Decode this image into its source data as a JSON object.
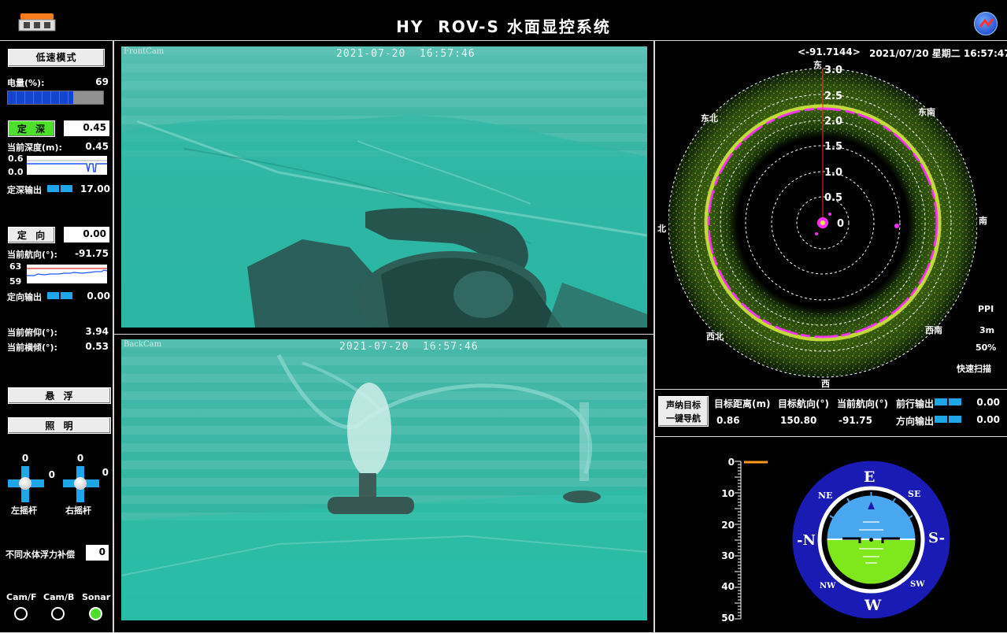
{
  "header": {
    "title": "HY  ROV-S 水面显控系统"
  },
  "left": {
    "mode_button": "低速模式",
    "battery_label": "电量(%):",
    "battery_value": "69",
    "battery_percent": 69,
    "depth_hold_button": "定  深",
    "depth_setpoint": "0.45",
    "current_depth_label": "当前深度(m):",
    "current_depth_value": "0.45",
    "depth_chart_max": "0.6",
    "depth_chart_min": "0.0",
    "depth_output_label": "定深输出",
    "depth_output_value": "17.00",
    "heading_hold_button": "定  向",
    "heading_setpoint": "0.00",
    "current_heading_label": "当前航向(°):",
    "current_heading_value": "-91.75",
    "heading_chart_max": "63",
    "heading_chart_min": "59",
    "heading_output_label": "定向输出",
    "heading_output_value": "0.00",
    "pitch_label": "当前俯仰(°):",
    "pitch_value": "3.94",
    "roll_label": "当前横倾(°):",
    "roll_value": "0.53",
    "hover_button": "悬  浮",
    "light_button": "照  明",
    "left_stick": {
      "top": "0",
      "right": "0",
      "label": "左摇杆"
    },
    "right_stick": {
      "top": "0",
      "right": "0",
      "label": "右摇杆"
    },
    "buoyancy_label": "不同水体浮力补偿",
    "buoyancy_value": "0",
    "sources": [
      {
        "label": "Cam/F",
        "selected": false
      },
      {
        "label": "Cam/B",
        "selected": false
      },
      {
        "label": "Sonar",
        "selected": true
      }
    ]
  },
  "cameras": {
    "front": {
      "name": "FrontCam",
      "timestamp": "2021-07-20  16:57:46"
    },
    "back": {
      "name": "BackCam",
      "timestamp": "2021-07-20  16:57:46"
    }
  },
  "sonar": {
    "heading_readout": "<-91.7144>",
    "datetime": "2021/07/20 星期二 16:57:47",
    "compass_labels": {
      "east": "东",
      "southeast": "东南",
      "south": "南",
      "southwest": "西南",
      "west": "西",
      "northwest": "西北",
      "north": "北",
      "northeast": "东北"
    },
    "range_labels": [
      "3.0",
      "2.5",
      "2.0",
      "1.5",
      "1.0",
      "0.5",
      "0"
    ],
    "mode": "PPI",
    "range": "3m",
    "gain": "50%",
    "scan": "快速扫描",
    "nav_button_line1": "声纳目标",
    "nav_button_line2": "一键导航",
    "target_distance_label": "目标距离(m)",
    "target_distance_value": "0.86",
    "target_heading_label": "目标航向(°)",
    "target_heading_value": "150.80",
    "current_heading_label": "当前航向(°)",
    "current_heading_value": "-91.75",
    "forward_output_label": "前行输出",
    "forward_output_value": "0.00",
    "direction_output_label": "方向输出",
    "direction_output_value": "0.00"
  },
  "depth_scale": {
    "ticks": [
      "0",
      "10",
      "20",
      "30",
      "40",
      "50"
    ]
  },
  "attitude": {
    "E": "E",
    "NE": "NE",
    "SE": "SE",
    "N": "-N",
    "S": "S-",
    "NW": "NW",
    "SW": "SW",
    "W": "W"
  },
  "colors": {
    "accent_green": "#4ce02a",
    "bar_blue": "#1fa6e8",
    "sky": "#4aa8f0",
    "ground": "#7fe81c",
    "bezel": "#1a1ab4"
  }
}
